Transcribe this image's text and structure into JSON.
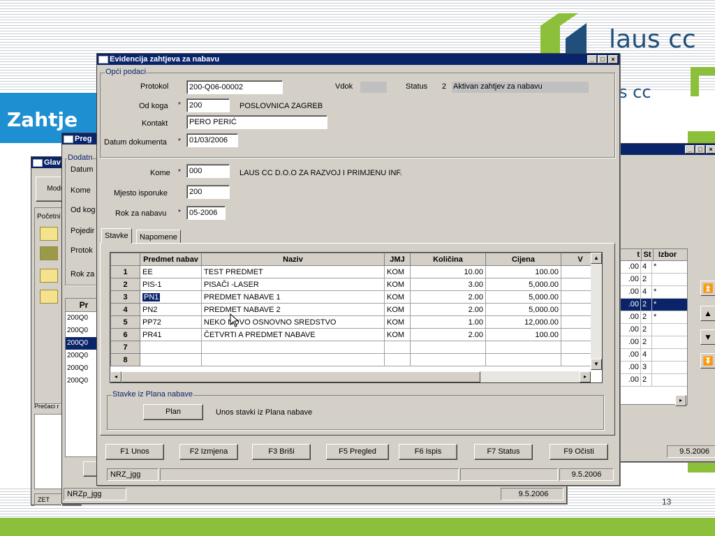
{
  "slide": {
    "title": "Zahtje",
    "logo_text_1": "laus cc",
    "logo_text_2": "s cc",
    "page_number": "13",
    "accent_color": "#1e8fd0",
    "footer_color": "#8cbf3a"
  },
  "bg_window_1": {
    "title": "Glav",
    "labels": [
      "Modul",
      "Početni",
      "Prečaci r",
      "ZET"
    ]
  },
  "bg_window_2": {
    "title": "Preg",
    "group": "Dodatn",
    "labels": [
      "Datum",
      "Kome",
      "Od kog",
      "Pojedir",
      "Protok",
      "Rok za"
    ],
    "list_header": "Pr",
    "list_items": [
      "200Q0",
      "200Q0",
      "200Q0",
      "200Q0",
      "200Q0",
      "200Q0"
    ],
    "status_user": "NRZp_jgg",
    "status_date": "9.5.2006"
  },
  "bg_window_3": {
    "col_headers": [
      "t",
      "St",
      "Izbor"
    ],
    "rows": [
      {
        "t": ".00",
        "st": "4",
        "izbor": "*"
      },
      {
        "t": ".00",
        "st": "2",
        "izbor": ""
      },
      {
        "t": ".00",
        "st": "4",
        "izbor": "*"
      },
      {
        "t": ".00",
        "st": "2",
        "izbor": "*"
      },
      {
        "t": ".00",
        "st": "2",
        "izbor": "*"
      },
      {
        "t": ".00",
        "st": "2",
        "izbor": ""
      },
      {
        "t": ".00",
        "st": "2",
        "izbor": ""
      },
      {
        "t": ".00",
        "st": "4",
        "izbor": ""
      },
      {
        "t": ".00",
        "st": "3",
        "izbor": ""
      },
      {
        "t": ".00",
        "st": "2",
        "izbor": ""
      }
    ],
    "status_date": "9.5.2006"
  },
  "main": {
    "title": "Evidencija zahtjeva za nabavu",
    "group_general": "Opći podaci",
    "protokol_label": "Protokol",
    "protokol_value": "200-Q06-00002",
    "vdok_label": "Vdok",
    "status_label": "Status",
    "status_code": "2",
    "status_text": "Aktivan zahtjev za nabavu",
    "od_koga_label": "Od koga",
    "od_koga_code": "200",
    "od_koga_name": "POSLOVNICA ZAGREB",
    "kontakt_label": "Kontakt",
    "kontakt_value": "PERO PERIĆ",
    "datum_label": "Datum dokumenta",
    "datum_value": "01/03/2006",
    "required_mark": "*",
    "kome_label": "Kome",
    "kome_code": "000",
    "kome_name": "LAUS CC D.O.O ZA RAZVOJ I PRIMJENU INF.",
    "mjesto_label": "Mjesto isporuke",
    "mjesto_value": "200",
    "rok_label": "Rok za nabavu",
    "rok_value": "05-2006",
    "tabs": [
      "Stavke",
      "Napomene"
    ],
    "grid": {
      "headers": [
        "",
        "Predmet nabav",
        "Naziv",
        "JMJ",
        "Količina",
        "Cijena",
        "V"
      ],
      "rows": [
        {
          "n": "1",
          "code": "EE",
          "name": "TEST PREDMET",
          "jmj": "KOM",
          "qty": "10.00",
          "price": "100.00"
        },
        {
          "n": "2",
          "code": "PIS-1",
          "name": "PISAČI -LASER",
          "jmj": "KOM",
          "qty": "3.00",
          "price": "5,000.00"
        },
        {
          "n": "3",
          "code": "PN1",
          "name": "PREDMET NABAVE 1",
          "jmj": "KOM",
          "qty": "2.00",
          "price": "5,000.00"
        },
        {
          "n": "4",
          "code": "PN2",
          "name": "PREDMET NABAVE 2",
          "jmj": "KOM",
          "qty": "2.00",
          "price": "5,000.00"
        },
        {
          "n": "5",
          "code": "PP72",
          "name": "NEKO NOVO OSNOVNO SREDSTVO",
          "jmj": "KOM",
          "qty": "1.00",
          "price": "12,000.00"
        },
        {
          "n": "6",
          "code": "PR41",
          "name": "ČETVRTI A PREDMET NABAVE",
          "jmj": "KOM",
          "qty": "2.00",
          "price": "100.00"
        },
        {
          "n": "7",
          "code": "",
          "name": "",
          "jmj": "",
          "qty": "",
          "price": ""
        },
        {
          "n": "8",
          "code": "",
          "name": "",
          "jmj": "",
          "qty": "",
          "price": ""
        }
      ]
    },
    "plan_group": "Stavke iz Plana nabave",
    "plan_button": "Plan",
    "plan_text": "Unos stavki iz Plana nabave",
    "fkeys": [
      "F1 Unos",
      "F2 Izmjena",
      "F3 Briši",
      "F5 Pregled",
      "F6 Ispis",
      "F7 Status",
      "F9 Očisti"
    ],
    "status_user": "NRZ_jgg",
    "status_date": "9.5.2006"
  }
}
